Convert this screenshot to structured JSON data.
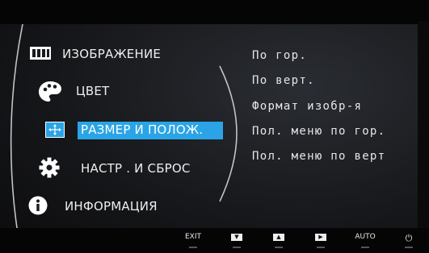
{
  "menu": {
    "items": [
      {
        "label": "ИЗОБРАЖЕНИЕ",
        "icon": "picture-icon"
      },
      {
        "label": "ЦВЕТ",
        "icon": "palette-icon"
      },
      {
        "label": "РАЗМЕР И ПОЛОЖ.",
        "icon": "size-position-icon",
        "selected": true
      },
      {
        "label": "НАСТР . И СБРОС",
        "icon": "gear-icon"
      },
      {
        "label": "ИНФОРМАЦИЯ",
        "icon": "info-icon"
      }
    ]
  },
  "submenu": {
    "items": [
      "По гор.",
      "По верт.",
      "Формат изобр-я",
      "Пол. меню по гор.",
      "Пол. меню по верт"
    ]
  },
  "buttons": [
    {
      "label": "EXIT"
    },
    {
      "label": "▼",
      "icon": "down-triangle-icon"
    },
    {
      "label": "▲",
      "icon": "up-triangle-icon"
    },
    {
      "label": "▶",
      "icon": "right-triangle-icon"
    },
    {
      "label": "AUTO"
    },
    {
      "label": "⏻",
      "icon": "power-icon"
    }
  ],
  "colors": {
    "accent": "#2aa4e6",
    "text": "#eeeeee",
    "background": "#17181b"
  }
}
